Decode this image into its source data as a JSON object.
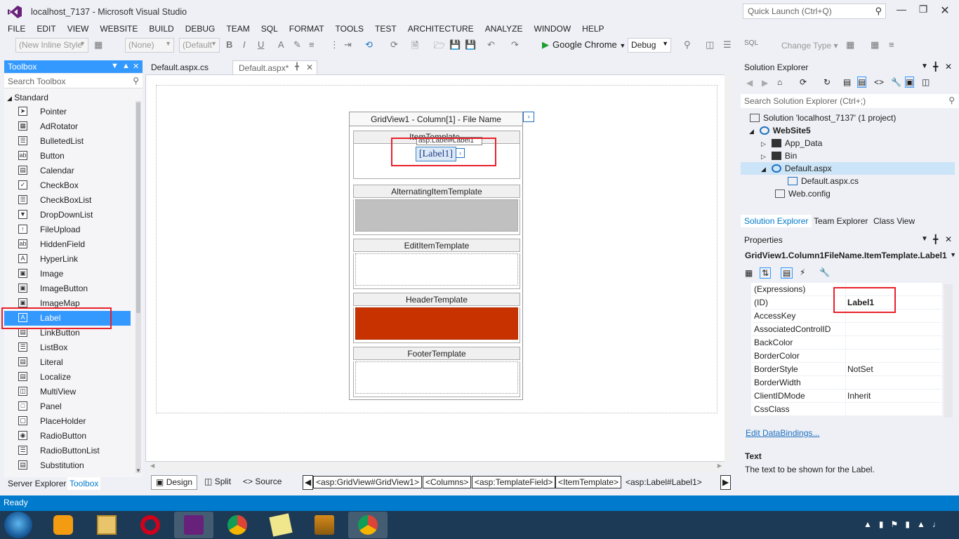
{
  "window": {
    "title": "localhost_7137 - Microsoft Visual Studio",
    "quick_launch": "Quick Launch (Ctrl+Q)"
  },
  "menu": [
    "FILE",
    "EDIT",
    "VIEW",
    "WEBSITE",
    "BUILD",
    "DEBUG",
    "TEAM",
    "SQL",
    "FORMAT",
    "TOOLS",
    "TEST",
    "ARCHITECTURE",
    "ANALYZE",
    "WINDOW",
    "HELP"
  ],
  "toolbar": {
    "style_combo": "(New Inline Style",
    "target_combo": "(None)",
    "font_combo": "(Default",
    "run_label": "Google Chrome",
    "config_combo": "Debug",
    "change_type": "Change Type"
  },
  "toolbox": {
    "title": "Toolbox",
    "search_placeholder": "Search Toolbox",
    "group": "Standard",
    "items": [
      "Pointer",
      "AdRotator",
      "BulletedList",
      "Button",
      "Calendar",
      "CheckBox",
      "CheckBoxList",
      "DropDownList",
      "FileUpload",
      "HiddenField",
      "HyperLink",
      "Image",
      "ImageButton",
      "ImageMap",
      "Label",
      "LinkButton",
      "ListBox",
      "Literal",
      "Localize",
      "MultiView",
      "Panel",
      "PlaceHolder",
      "RadioButton",
      "RadioButtonList",
      "Substitution"
    ],
    "selected": "Label",
    "tabs": [
      "Server Explorer",
      "Toolbox"
    ]
  },
  "doc_tabs": [
    "Default.aspx.cs",
    "Default.aspx*"
  ],
  "designer": {
    "grid_title": "GridView1 - Column[1] - File Name",
    "item_template": "ItemTemplate",
    "label_tag": "asp:Label#Label1",
    "label_text": "[Label1]",
    "templates": [
      "AlternatingItemTemplate",
      "EditItemTemplate",
      "HeaderTemplate",
      "FooterTemplate"
    ],
    "header_color": "#c83200",
    "alt_color": "#c0c0c0",
    "views": [
      "Design",
      "Split",
      "Source"
    ],
    "breadcrumbs": [
      "<asp:GridView#GridView1>",
      "<Columns>",
      "<asp:TemplateField>",
      "<ItemTemplate>",
      "<asp:Label#Label1>"
    ]
  },
  "solution_explorer": {
    "title": "Solution Explorer",
    "search_placeholder": "Search Solution Explorer (Ctrl+;)",
    "nodes": [
      "Solution 'localhost_7137' (1 project)",
      "WebSite5",
      "App_Data",
      "Bin",
      "Default.aspx",
      "Default.aspx.cs",
      "Web.config"
    ],
    "tabs": [
      "Solution Explorer",
      "Team Explorer",
      "Class View"
    ]
  },
  "properties": {
    "title": "Properties",
    "object": "GridView1.Column1FileName.ItemTemplate.Label1",
    "rows": [
      {
        "name": "(Expressions)",
        "value": ""
      },
      {
        "name": "(ID)",
        "value": "Label1"
      },
      {
        "name": "AccessKey",
        "value": ""
      },
      {
        "name": "AssociatedControlID",
        "value": ""
      },
      {
        "name": "BackColor",
        "value": ""
      },
      {
        "name": "BorderColor",
        "value": ""
      },
      {
        "name": "BorderStyle",
        "value": "NotSet"
      },
      {
        "name": "BorderWidth",
        "value": ""
      },
      {
        "name": "ClientIDMode",
        "value": "Inherit"
      },
      {
        "name": "CssClass",
        "value": ""
      }
    ],
    "edit_databindings": "Edit DataBindings...",
    "desc_name": "Text",
    "desc_text": "The text to be shown for the Label."
  },
  "status": {
    "text": "Ready"
  },
  "accent": "#007acc",
  "highlight": "#e8212b"
}
